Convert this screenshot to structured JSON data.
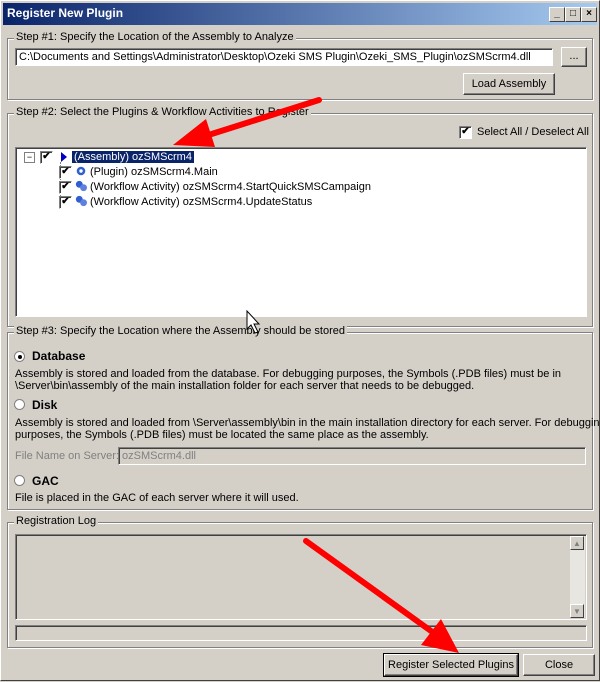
{
  "window": {
    "title": "Register New Plugin",
    "controls": {
      "minimize": "_",
      "maximize": "□",
      "close": "×"
    }
  },
  "step1": {
    "legend": "Step #1: Specify the Location of the Assembly to Analyze",
    "path_value": "C:\\Documents and Settings\\Administrator\\Desktop\\Ozeki SMS Plugin\\Ozeki_SMS_Plugin\\ozSMScrm4.dll",
    "browse_label": "...",
    "load_label": "Load Assembly"
  },
  "step2": {
    "legend": "Step #2: Select the Plugins & Workflow Activities to Register",
    "select_all_label": "Select All / Deselect All",
    "select_all_checked": true,
    "tree": {
      "expander": "−",
      "root": {
        "label": "(Assembly) ozSMScrm4",
        "checked": true
      },
      "children": [
        {
          "label": "(Plugin) ozSMScrm4.Main",
          "checked": true
        },
        {
          "label": "(Workflow Activity) ozSMScrm4.StartQuickSMSCampaign",
          "checked": true
        },
        {
          "label": "(Workflow Activity) ozSMScrm4.UpdateStatus",
          "checked": true
        }
      ]
    }
  },
  "step3": {
    "legend": "Step #3: Specify the Location where the Assembly should be stored",
    "database_label": "Database",
    "database_selected": true,
    "database_desc1": "Assembly is stored and loaded from the database. For debugging purposes, the Symbols (.PDB files) must be in",
    "database_desc2": "\\Server\\bin\\assembly of the main installation folder for each server that needs to be debugged.",
    "disk_label": "Disk",
    "disk_desc1": "Assembly is stored and loaded from \\Server\\assembly\\bin in the main installation directory for each server. For debugging",
    "disk_desc2": "purposes, the Symbols (.PDB files) must be located the same place as the assembly.",
    "file_name_label": "File Name on Server:",
    "file_name_value": "ozSMScrm4.dll",
    "gac_label": "GAC",
    "gac_desc": "File is placed in the GAC of each server where it will used."
  },
  "log": {
    "legend": "Registration Log",
    "scroll_up": "▲",
    "scroll_down": "▼"
  },
  "footer": {
    "register_label": "Register Selected Plugins",
    "close_label": "Close"
  },
  "colors": {
    "annotation_arrow": "#ff0000",
    "title_bar": "#0a246a"
  }
}
